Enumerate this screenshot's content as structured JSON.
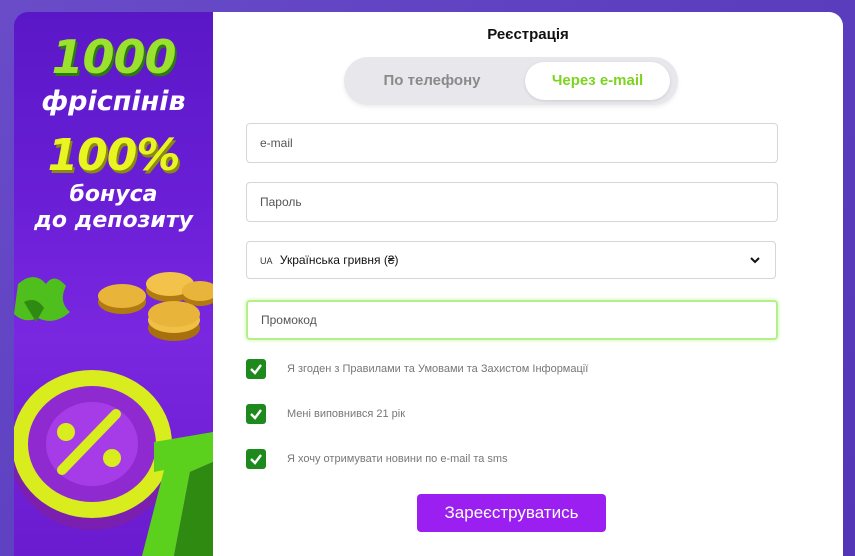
{
  "promo": {
    "freespins_count": "1000",
    "freespins_label": "фріспінів",
    "bonus_percent": "100%",
    "bonus_line1": "бонуса",
    "bonus_line2": "до депозиту"
  },
  "form": {
    "title": "Реєстрація",
    "tabs": [
      {
        "label": "По телефону",
        "active": false
      },
      {
        "label": "Через e-mail",
        "active": true
      }
    ],
    "email_placeholder": "e-mail",
    "password_placeholder": "Пароль",
    "currency": {
      "code": "UA",
      "selected": "Українська гривня (₴)"
    },
    "promo_placeholder": "Промокод",
    "checkboxes": [
      {
        "label": "Я згоден з Правилами та Умовами та Захистом Інформації",
        "checked": true
      },
      {
        "label": "Мені виповнився 21 рік",
        "checked": true
      },
      {
        "label": "Я хочу отримувати новини по e-mail та sms",
        "checked": true
      }
    ],
    "submit_label": "Зареєструватись"
  },
  "colors": {
    "accent_green": "#7ed321",
    "checkbox_green": "#1e8a1e",
    "submit_purple": "#9b1ff0",
    "banner_purple": "#6a1fd6",
    "promo_field_glow": "#b4ef8c"
  }
}
